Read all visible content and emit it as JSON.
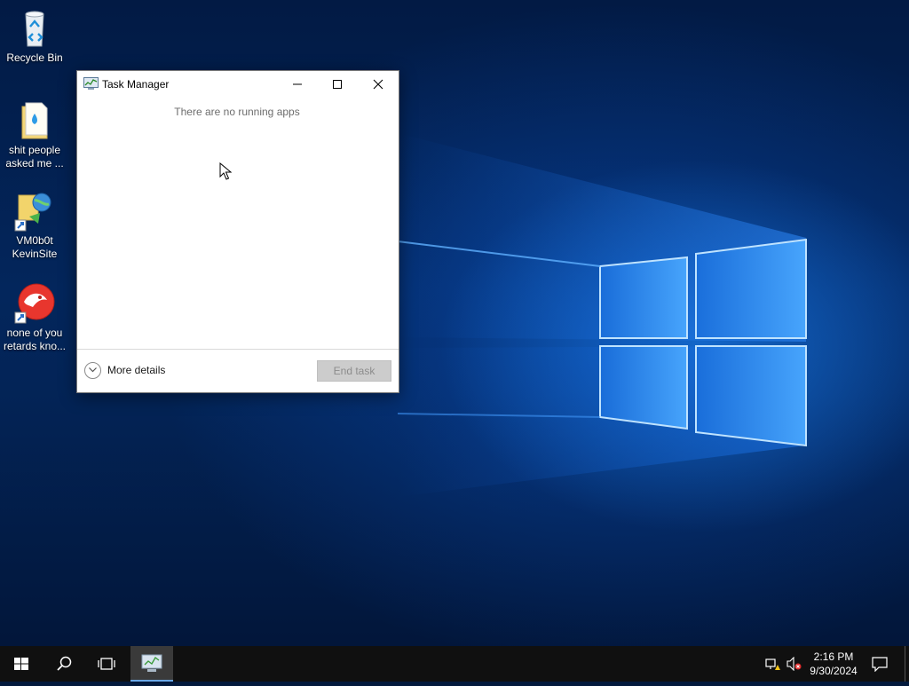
{
  "desktop": {
    "icons": [
      {
        "label": "Recycle Bin",
        "icon": "recycle-bin-icon"
      },
      {
        "label": "shit people asked me ...",
        "line1": "shit people",
        "line2": "asked me ...",
        "icon": "text-document-icon"
      },
      {
        "label": "VM0b0t KevinSite",
        "line1": "VM0b0t",
        "line2": "KevinSite",
        "icon": "web-shortcut-icon"
      },
      {
        "label": "none of you retards kno...",
        "line1": "none of you",
        "line2": "retards kno...",
        "icon": "app-shortcut-icon"
      }
    ]
  },
  "task_manager": {
    "title": "Task Manager",
    "empty_message": "There are no running apps",
    "more_details_label": "More details",
    "end_task_label": "End task"
  },
  "taskbar": {
    "clock_time": "2:16 PM",
    "clock_date": "9/30/2024",
    "active_app": "Task Manager"
  },
  "colors": {
    "taskbar": "#101010",
    "accent_underline": "#6aa7e6",
    "wallpaper_blue": "#0a64d2"
  }
}
